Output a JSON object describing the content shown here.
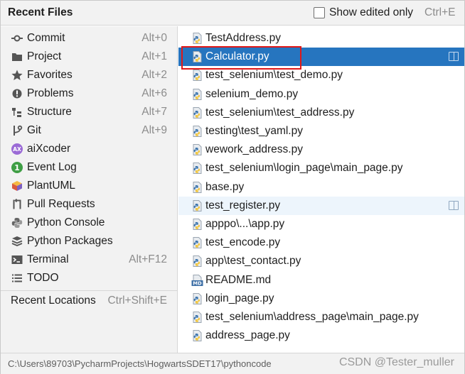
{
  "header": {
    "title": "Recent Files",
    "checkbox_label": "Show edited only",
    "checkbox_shortcut": "Ctrl+E",
    "checkbox_checked": false
  },
  "nav": {
    "items": [
      {
        "label": "Commit",
        "shortcut": "Alt+0",
        "icon": "commit-icon"
      },
      {
        "label": "Project",
        "shortcut": "Alt+1",
        "icon": "folder-icon"
      },
      {
        "label": "Favorites",
        "shortcut": "Alt+2",
        "icon": "star-icon"
      },
      {
        "label": "Problems",
        "shortcut": "Alt+6",
        "icon": "warning-icon"
      },
      {
        "label": "Structure",
        "shortcut": "Alt+7",
        "icon": "structure-icon"
      },
      {
        "label": "Git",
        "shortcut": "Alt+9",
        "icon": "git-branch-icon"
      },
      {
        "label": "aiXcoder",
        "shortcut": "",
        "icon": "aixcoder-icon"
      },
      {
        "label": "Event Log",
        "shortcut": "",
        "icon": "event-log-icon"
      },
      {
        "label": "PlantUML",
        "shortcut": "",
        "icon": "plantuml-icon"
      },
      {
        "label": "Pull Requests",
        "shortcut": "",
        "icon": "pull-request-icon"
      },
      {
        "label": "Python Console",
        "shortcut": "",
        "icon": "python-icon"
      },
      {
        "label": "Python Packages",
        "shortcut": "",
        "icon": "packages-icon"
      },
      {
        "label": "Terminal",
        "shortcut": "Alt+F12",
        "icon": "terminal-icon"
      },
      {
        "label": "TODO",
        "shortcut": "",
        "icon": "todo-list-icon"
      }
    ],
    "recent_locations": {
      "label": "Recent Locations",
      "shortcut": "Ctrl+Shift+E"
    }
  },
  "files": [
    {
      "name": "TestAddress.py",
      "type": "python"
    },
    {
      "name": "Calculator.py",
      "type": "python",
      "selected": true
    },
    {
      "name": "test_selenium\\test_demo.py",
      "type": "python"
    },
    {
      "name": "selenium_demo.py",
      "type": "python"
    },
    {
      "name": "test_selenium\\test_address.py",
      "type": "python"
    },
    {
      "name": "testing\\test_yaml.py",
      "type": "python"
    },
    {
      "name": "wework_address.py",
      "type": "python"
    },
    {
      "name": "test_selenium\\login_page\\main_page.py",
      "type": "python"
    },
    {
      "name": "base.py",
      "type": "python"
    },
    {
      "name": "test_register.py",
      "type": "python",
      "hovered": true
    },
    {
      "name": "apppo\\...\\app.py",
      "type": "python"
    },
    {
      "name": "test_encode.py",
      "type": "python"
    },
    {
      "name": "app\\test_contact.py",
      "type": "python"
    },
    {
      "name": "README.md",
      "type": "markdown"
    },
    {
      "name": "login_page.py",
      "type": "python"
    },
    {
      "name": "test_selenium\\address_page\\main_page.py",
      "type": "python"
    },
    {
      "name": "address_page.py",
      "type": "python"
    }
  ],
  "footer": {
    "path": "C:\\Users\\89703\\PycharmProjects\\HogwartsSDET17\\pythoncode",
    "watermark": "CSDN @Tester_muller"
  },
  "colors": {
    "selection": "#2675bf",
    "hover": "#edf5fc",
    "highlight_border": "#e01818",
    "panel_bg": "#f2f2f2"
  }
}
